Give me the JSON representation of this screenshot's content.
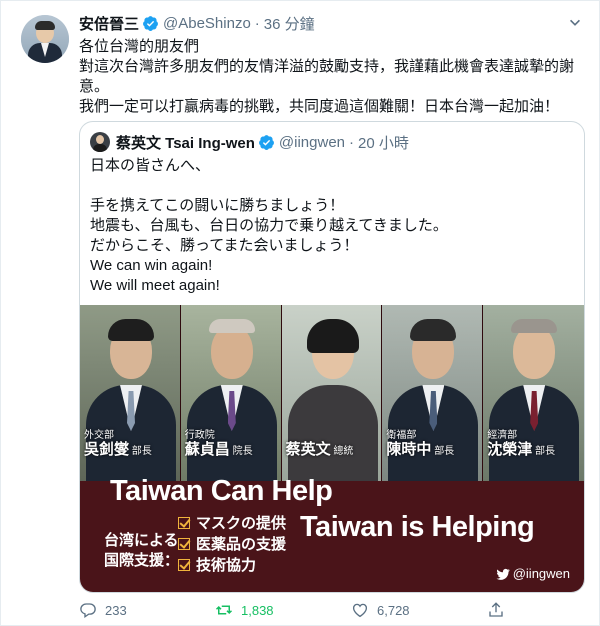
{
  "tweet": {
    "author_name": "安倍晉三",
    "handle": "@AbeShinzo",
    "separator": "·",
    "time": "36 分鐘",
    "lines": [
      "各位台灣的朋友們",
      "對這次台灣許多朋友們的友情洋溢的鼓勵支持，我謹藉此機會表達誠摯的謝意。",
      "我們一定可以打贏病毒的挑戰，共同度過這個難關！日本台灣一起加油！"
    ]
  },
  "quoted": {
    "author_name": "蔡英文 Tsai Ing-wen",
    "handle": "@iingwen",
    "separator": "·",
    "time": "20 小時",
    "lines": [
      "日本の皆さんへ、",
      "",
      "手を携えてこの闘いに勝ちましょう！",
      "地震も、台風も、台日の協力で乗り越えてきました。",
      "だからこそ、勝ってまた会いましょう！",
      "We can win again!",
      "We will meet again!"
    ],
    "image": {
      "people": [
        {
          "title": "外交部",
          "name": "吳釗燮",
          "role": "部長"
        },
        {
          "title": "行政院",
          "name": "蘇貞昌",
          "role": "院長"
        },
        {
          "title": "",
          "name": "蔡英文",
          "role": "總統"
        },
        {
          "title": "衛福部",
          "name": "陳時中",
          "role": "部長"
        },
        {
          "title": "經濟部",
          "name": "沈榮津",
          "role": "部長"
        }
      ],
      "slogan_1": "Taiwan Can Help",
      "slogan_2": "Taiwan is Helping",
      "support_label": "台湾による国際支援：",
      "items": [
        "マスクの提供",
        "医薬品の支援",
        "技術協力"
      ],
      "credit": "@iingwen"
    }
  },
  "actions": {
    "reply_count": "233",
    "retweet_count": "1,838",
    "like_count": "6,728"
  },
  "colors": {
    "verified": "#1da1f2",
    "retweet": "#17bf63",
    "muted": "#5b7083",
    "banner": "#4a1419"
  }
}
